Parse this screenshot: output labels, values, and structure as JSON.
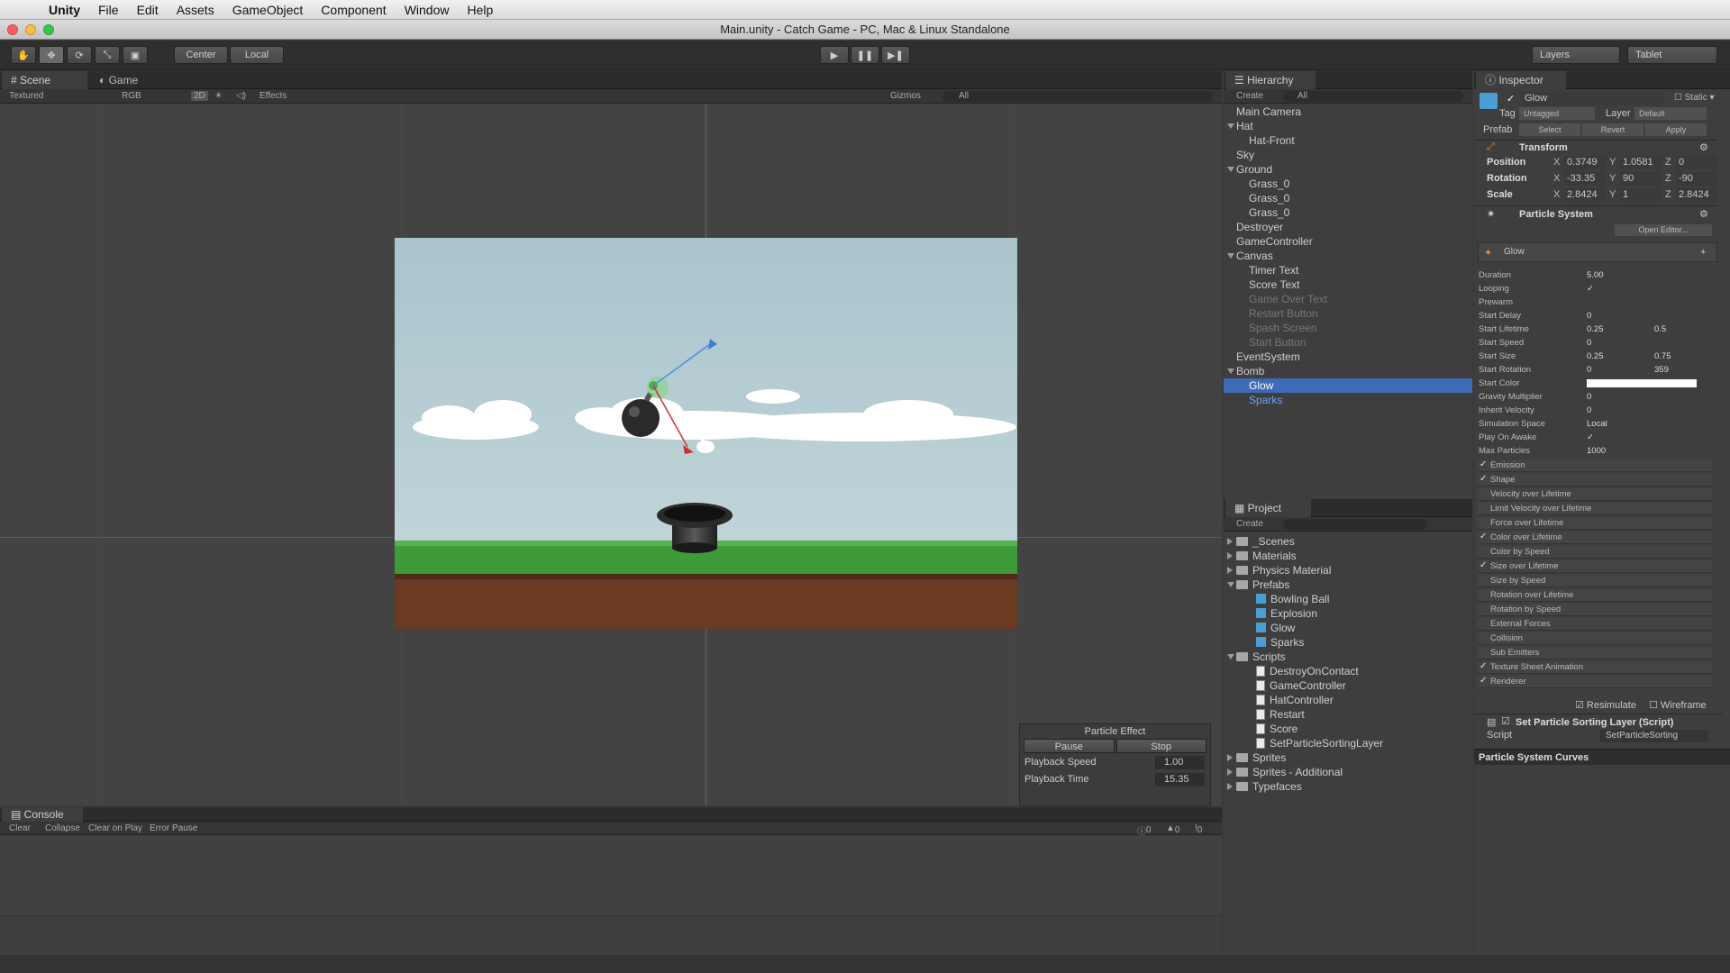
{
  "menubar": {
    "app": "Unity",
    "items": [
      "File",
      "Edit",
      "Assets",
      "GameObject",
      "Component",
      "Window",
      "Help"
    ]
  },
  "window": {
    "title": "Main.unity - Catch Game - PC, Mac & Linux Standalone"
  },
  "toolbar": {
    "center": "Center",
    "local": "Local",
    "layers": "Layers",
    "layout": "Tablet"
  },
  "scene": {
    "tab_scene": "Scene",
    "tab_game": "Game",
    "shading": "Textured",
    "rgb": "RGB",
    "mode2d": "2D",
    "effects": "Effects",
    "gizmos": "Gizmos",
    "search": "All"
  },
  "particle_effect": {
    "title": "Particle Effect",
    "pause": "Pause",
    "stop": "Stop",
    "speed_label": "Playback Speed",
    "speed_value": "1.00",
    "time_label": "Playback Time",
    "time_value": "15.35"
  },
  "console": {
    "tab": "Console",
    "buttons": [
      "Clear",
      "Collapse",
      "Clear on Play",
      "Error Pause"
    ],
    "counts": [
      "0",
      "0",
      "0"
    ]
  },
  "hierarchy": {
    "tab": "Hierarchy",
    "create": "Create",
    "search": "All",
    "items": [
      {
        "label": "Main Camera",
        "depth": 0,
        "state": "normal",
        "fold": false
      },
      {
        "label": "Hat",
        "depth": 0,
        "state": "normal",
        "fold": true
      },
      {
        "label": "Hat-Front",
        "depth": 1,
        "state": "normal",
        "fold": false
      },
      {
        "label": "Sky",
        "depth": 0,
        "state": "normal",
        "fold": false
      },
      {
        "label": "Ground",
        "depth": 0,
        "state": "normal",
        "fold": true
      },
      {
        "label": "Grass_0",
        "depth": 1,
        "state": "normal",
        "fold": false
      },
      {
        "label": "Grass_0",
        "depth": 1,
        "state": "normal",
        "fold": false
      },
      {
        "label": "Grass_0",
        "depth": 1,
        "state": "normal",
        "fold": false
      },
      {
        "label": "Destroyer",
        "depth": 0,
        "state": "normal",
        "fold": false
      },
      {
        "label": "GameController",
        "depth": 0,
        "state": "normal",
        "fold": false
      },
      {
        "label": "Canvas",
        "depth": 0,
        "state": "normal",
        "fold": true
      },
      {
        "label": "Timer Text",
        "depth": 1,
        "state": "normal",
        "fold": false
      },
      {
        "label": "Score Text",
        "depth": 1,
        "state": "normal",
        "fold": false
      },
      {
        "label": "Game Over Text",
        "depth": 1,
        "state": "dim",
        "fold": false
      },
      {
        "label": "Restart Button",
        "depth": 1,
        "state": "dim",
        "fold": false
      },
      {
        "label": "Spash Screen",
        "depth": 1,
        "state": "dim",
        "fold": false
      },
      {
        "label": "Start Button",
        "depth": 1,
        "state": "dim",
        "fold": false
      },
      {
        "label": "EventSystem",
        "depth": 0,
        "state": "normal",
        "fold": false
      },
      {
        "label": "Bomb",
        "depth": 0,
        "state": "normal",
        "fold": true
      },
      {
        "label": "Glow",
        "depth": 1,
        "state": "selected",
        "fold": false
      },
      {
        "label": "Sparks",
        "depth": 1,
        "state": "blue",
        "fold": false
      }
    ]
  },
  "project": {
    "tab": "Project",
    "create": "Create",
    "items": [
      {
        "label": "_Scenes",
        "depth": 0,
        "kind": "folder",
        "fold": false
      },
      {
        "label": "Materials",
        "depth": 0,
        "kind": "folder",
        "fold": false
      },
      {
        "label": "Physics Material",
        "depth": 0,
        "kind": "folder",
        "fold": false
      },
      {
        "label": "Prefabs",
        "depth": 0,
        "kind": "folder",
        "fold": true
      },
      {
        "label": "Bowling Ball",
        "depth": 1,
        "kind": "prefab",
        "fold": false
      },
      {
        "label": "Explosion",
        "depth": 1,
        "kind": "prefab",
        "fold": false
      },
      {
        "label": "Glow",
        "depth": 1,
        "kind": "prefab",
        "fold": false
      },
      {
        "label": "Sparks",
        "depth": 1,
        "kind": "prefab",
        "fold": false
      },
      {
        "label": "Scripts",
        "depth": 0,
        "kind": "folder",
        "fold": true
      },
      {
        "label": "DestroyOnContact",
        "depth": 1,
        "kind": "script",
        "fold": false
      },
      {
        "label": "GameController",
        "depth": 1,
        "kind": "script",
        "fold": false
      },
      {
        "label": "HatController",
        "depth": 1,
        "kind": "script",
        "fold": false
      },
      {
        "label": "Restart",
        "depth": 1,
        "kind": "script",
        "fold": false
      },
      {
        "label": "Score",
        "depth": 1,
        "kind": "script",
        "fold": false
      },
      {
        "label": "SetParticleSortingLayer",
        "depth": 1,
        "kind": "script",
        "fold": false
      },
      {
        "label": "Sprites",
        "depth": 0,
        "kind": "folder",
        "fold": false
      },
      {
        "label": "Sprites - Additional",
        "depth": 0,
        "kind": "folder",
        "fold": false
      },
      {
        "label": "Typefaces",
        "depth": 0,
        "kind": "folder",
        "fold": false
      }
    ]
  },
  "inspector": {
    "tab": "Inspector",
    "name": "Glow",
    "static": "Static",
    "tag_label": "Tag",
    "tag": "Untagged",
    "layer_label": "Layer",
    "layer": "Default",
    "prefab_label": "Prefab",
    "select": "Select",
    "revert": "Revert",
    "apply": "Apply",
    "transform": {
      "title": "Transform",
      "position_label": "Position",
      "rotation_label": "Rotation",
      "scale_label": "Scale",
      "position": [
        "0.3749",
        "1.0581",
        "0"
      ],
      "rotation": [
        "-33.35",
        "90",
        "-90"
      ],
      "scale": [
        "2.8424",
        "1",
        "2.8424"
      ]
    },
    "particle_system": {
      "title": "Particle System",
      "open_editor": "Open Editor...",
      "module": "Glow",
      "fields": [
        {
          "label": "Duration",
          "v1": "5.00",
          "v2": ""
        },
        {
          "label": "Looping",
          "v1": "✓",
          "v2": ""
        },
        {
          "label": "Prewarm",
          "v1": "",
          "v2": ""
        },
        {
          "label": "Start Delay",
          "v1": "0",
          "v2": ""
        },
        {
          "label": "Start Lifetime",
          "v1": "0.25",
          "v2": "0.5"
        },
        {
          "label": "Start Speed",
          "v1": "0",
          "v2": ""
        },
        {
          "label": "Start Size",
          "v1": "0.25",
          "v2": "0.75"
        },
        {
          "label": "Start Rotation",
          "v1": "0",
          "v2": "359"
        },
        {
          "label": "Start Color",
          "v1": "",
          "v2": ""
        },
        {
          "label": "Gravity Multiplier",
          "v1": "0",
          "v2": ""
        },
        {
          "label": "Inherit Velocity",
          "v1": "0",
          "v2": ""
        },
        {
          "label": "Simulation Space",
          "v1": "Local",
          "v2": ""
        },
        {
          "label": "Play On Awake",
          "v1": "✓",
          "v2": ""
        },
        {
          "label": "Max Particles",
          "v1": "1000",
          "v2": ""
        }
      ],
      "modules": [
        {
          "label": "Emission",
          "checked": true
        },
        {
          "label": "Shape",
          "checked": true
        },
        {
          "label": "Velocity over Lifetime",
          "checked": false
        },
        {
          "label": "Limit Velocity over Lifetime",
          "checked": false
        },
        {
          "label": "Force over Lifetime",
          "checked": false
        },
        {
          "label": "Color over Lifetime",
          "checked": true
        },
        {
          "label": "Color by Speed",
          "checked": false
        },
        {
          "label": "Size over Lifetime",
          "checked": true
        },
        {
          "label": "Size by Speed",
          "checked": false
        },
        {
          "label": "Rotation over Lifetime",
          "checked": false
        },
        {
          "label": "Rotation by Speed",
          "checked": false
        },
        {
          "label": "External Forces",
          "checked": false
        },
        {
          "label": "Collision",
          "checked": false
        },
        {
          "label": "Sub Emitters",
          "checked": false
        },
        {
          "label": "Texture Sheet Animation",
          "checked": true
        },
        {
          "label": "Renderer",
          "checked": true
        }
      ],
      "resimulate": "Resimulate",
      "wireframe": "Wireframe"
    },
    "script_component": {
      "title": "Set Particle Sorting Layer (Script)",
      "script_label": "Script",
      "script_value": "SetParticleSorting"
    },
    "curves": "Particle System Curves"
  },
  "colors": {
    "selection": "#3d6bb8",
    "sky": "#b9d1d8",
    "grass": "#3f9a3a",
    "dirt": "#6b3a22"
  }
}
